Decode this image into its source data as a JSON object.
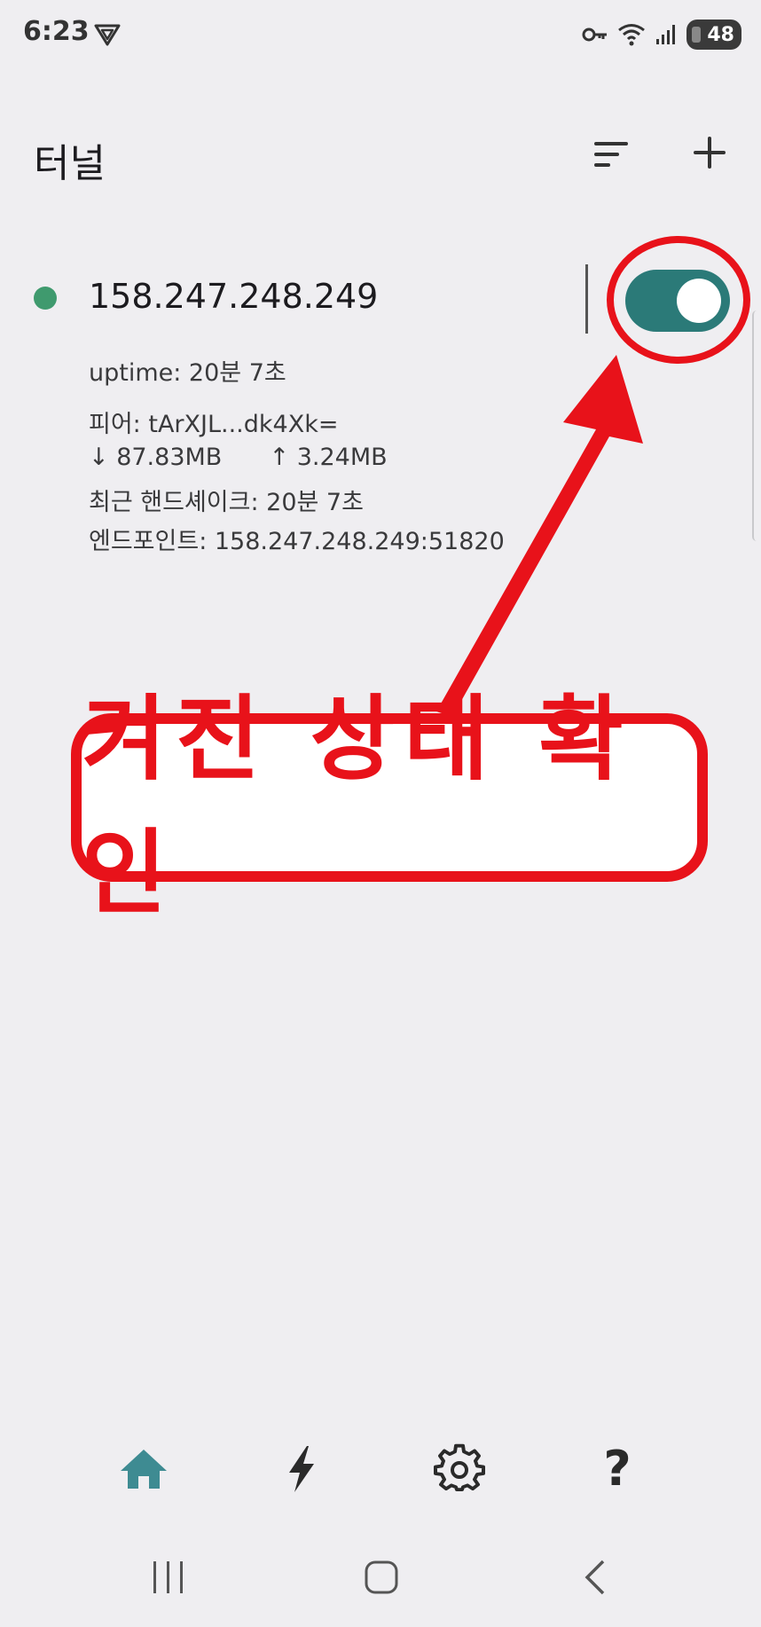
{
  "status_bar": {
    "time": "6:23",
    "battery": "48",
    "icons": [
      "vpn-triangle-icon",
      "key-icon",
      "wifi-icon",
      "signal-icon",
      "battery-icon"
    ]
  },
  "header": {
    "title": "터널",
    "actions": [
      "sort-icon",
      "add-icon"
    ]
  },
  "tunnel": {
    "name": "158.247.248.249",
    "active": true,
    "status_color": "#3f9a6e",
    "uptime": "uptime: 20분 7초",
    "peer": "피어: tArXJL...dk4Xk=",
    "rx": "↓ 87.83MB",
    "tx": "↑ 3.24MB",
    "handshake": "최근 핸드셰이크: 20분 7초",
    "endpoint": "엔드포인트: 158.247.248.249:51820"
  },
  "annotation": {
    "text": "켜진 상태 확인",
    "color": "#e8121a"
  },
  "bottom_nav": {
    "items": [
      "home-icon",
      "lightning-icon",
      "settings-icon",
      "help-icon"
    ],
    "active": "home-icon",
    "accent": "#3e8b92",
    "help_glyph": "?"
  },
  "system_nav": [
    "recents-icon",
    "home-circle-icon",
    "back-icon"
  ]
}
